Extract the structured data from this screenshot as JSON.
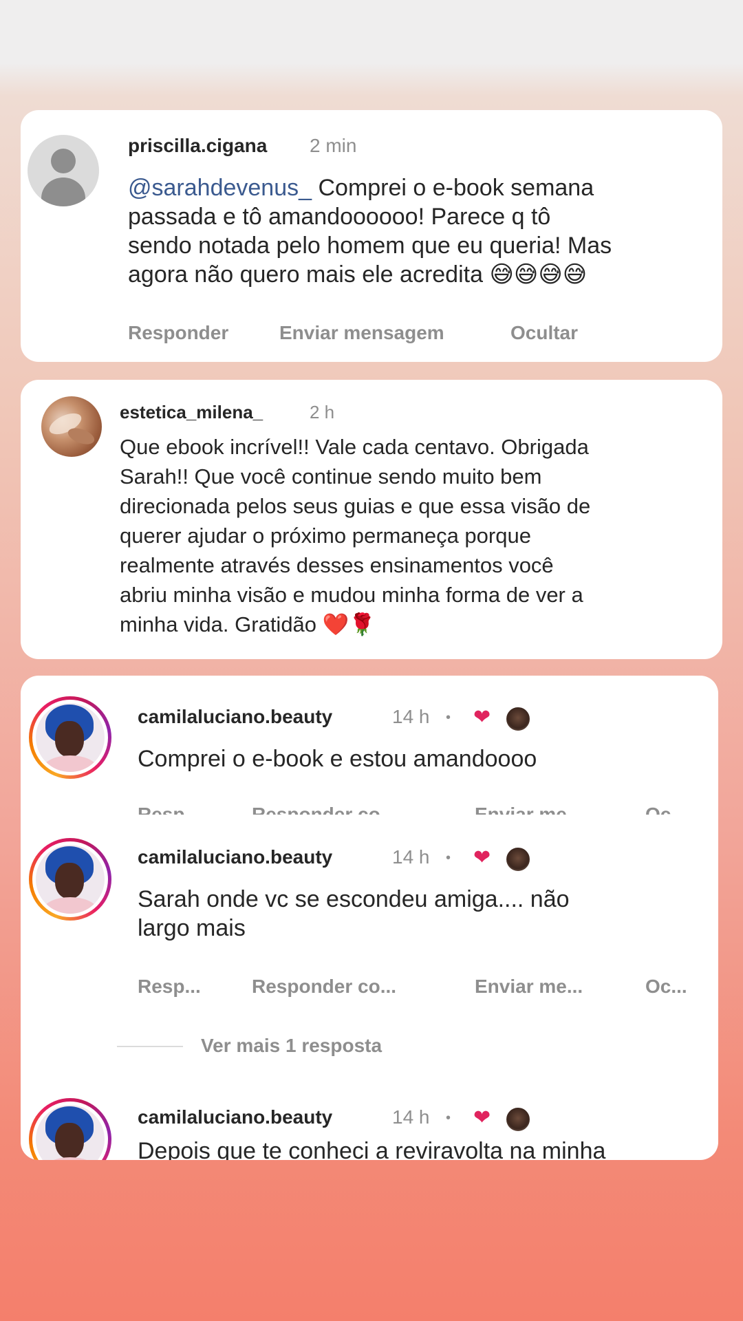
{
  "comments": [
    {
      "username": "priscilla.cigana",
      "time": "2 min",
      "mention": "@sarahdevenus_",
      "text_line1": " Comprei o e-book semana",
      "text_line2": "passada e tô amandoooooo! Parece q tô",
      "text_line3": "sendo notada pelo homem que eu queria! Mas",
      "text_line4": "agora não quero mais ele acredita 😅😅😅😅",
      "actions": [
        "Responder",
        "Enviar mensagem",
        "Ocultar"
      ]
    },
    {
      "username": "estetica_milena_",
      "time": "2 h",
      "lines": [
        "Que ebook incrível!! Vale cada centavo. Obrigada",
        "Sarah!! Que você continue sendo muito bem",
        "direcionada pelos seus guias e que essa visão de",
        "querer ajudar o próximo permaneça porque",
        "realmente através desses ensinamentos você",
        "abriu minha visão e mudou minha forma de ver a",
        "minha vida. Gratidão ❤️🌹"
      ]
    },
    {
      "username": "camilaluciano.beauty",
      "time": "14 h",
      "dot": "•",
      "text": "Comprei o e-book e estou amandoooo",
      "actions": [
        "Resp...",
        "Responder co...",
        "Enviar me...",
        "Oc..."
      ]
    },
    {
      "username": "camilaluciano.beauty",
      "time": "14 h",
      "dot": "•",
      "text_line1": "Sarah onde vc se escondeu amiga.... não",
      "text_line2": "largo mais",
      "actions": [
        "Resp...",
        "Responder co...",
        "Enviar me...",
        "Oc..."
      ],
      "more_replies": "Ver mais 1 resposta"
    },
    {
      "username": "camilaluciano.beauty",
      "time": "14 h",
      "dot": "•",
      "text": "Depois que te conheci a reviravolta na minha"
    }
  ],
  "icons": {
    "like": "heart-icon",
    "avatar_default": "person-icon"
  },
  "colors": {
    "heart": "#e0245e",
    "mention": "#3b5a8f",
    "secondary_text": "#8e8e8e"
  }
}
